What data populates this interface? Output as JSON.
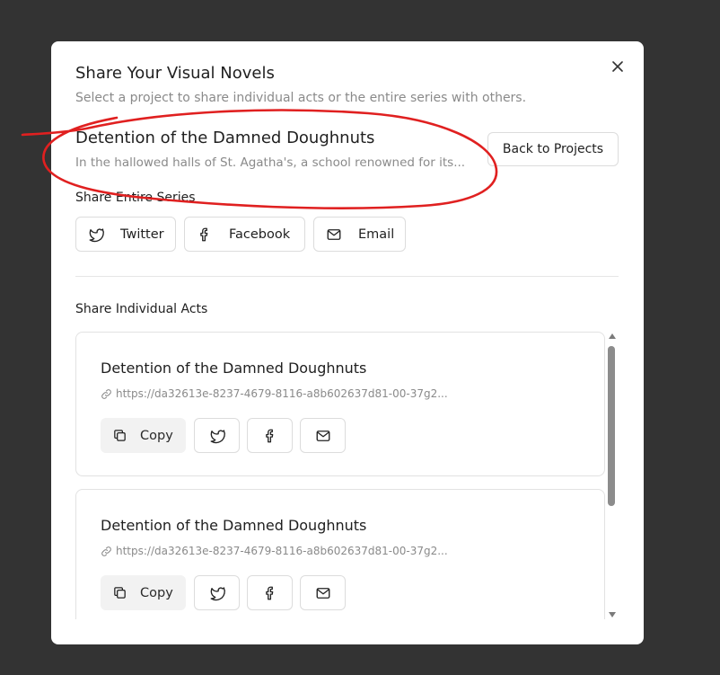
{
  "modal": {
    "title": "Share Your Visual Novels",
    "subtitle": "Select a project to share individual acts or the entire series with others.",
    "close_icon": "close-icon"
  },
  "project": {
    "title": "Detention of the Damned Doughnuts",
    "description": "In the hallowed halls of St. Agatha's, a school renowned for its...",
    "back_label": "Back to Projects"
  },
  "series": {
    "label": "Share Entire Series",
    "buttons": [
      {
        "label": "Twitter",
        "icon": "twitter-icon"
      },
      {
        "label": "Facebook",
        "icon": "facebook-icon"
      },
      {
        "label": "Email",
        "icon": "mail-icon"
      }
    ]
  },
  "acts": {
    "label": "Share Individual Acts",
    "items": [
      {
        "title": "Detention of the Damned Doughnuts",
        "link": "https://da32613e-8237-4679-8116-a8b602637d81-00-37g2...",
        "copy_label": "Copy"
      },
      {
        "title": "Detention of the Damned Doughnuts",
        "link": "https://da32613e-8237-4679-8116-a8b602637d81-00-37g2...",
        "copy_label": "Copy"
      }
    ]
  },
  "annotation": {
    "color": "#e02020",
    "shape": "hand-drawn ellipse around project title"
  }
}
